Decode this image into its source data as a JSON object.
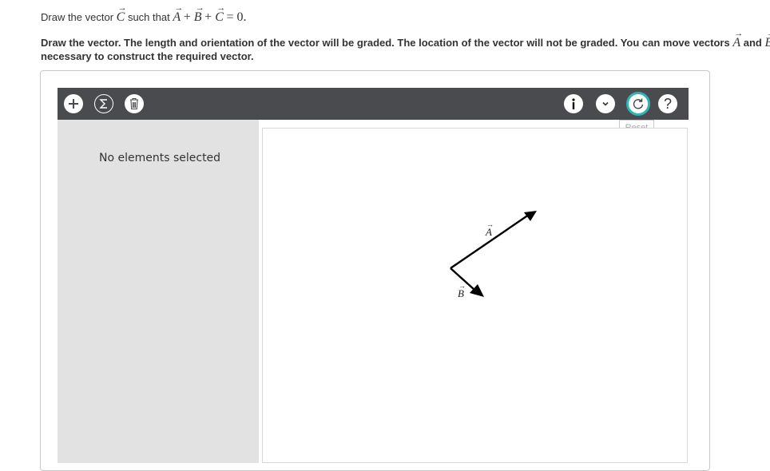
{
  "question": {
    "prefix": "Draw the vector ",
    "vec_c": "C",
    "middle": " such that ",
    "vec_a": "A",
    "plus1": " + ",
    "vec_b": "B",
    "plus2": " + ",
    "vec_c2": "C",
    "equals": " = 0."
  },
  "instructions": {
    "line1_prefix": "Draw the vector. The length and orientation of the vector will be graded. The location of the vector will not be graded. You can move vectors ",
    "vec_a": "A",
    "and": " and ",
    "vec_b_partial": "B",
    "line2": "necessary to construct the required vector."
  },
  "toolbar": {
    "add_icon": "plus-icon",
    "sum_icon": "sigma-icon",
    "delete_icon": "trash-icon",
    "info_icon": "info-icon",
    "chevron_icon": "chevron-down-icon",
    "reset_icon": "reset-icon",
    "help_label": "?",
    "reset_tooltip": "Reset"
  },
  "sidebar": {
    "status": "No elements selected"
  },
  "canvas": {
    "vectors": [
      {
        "label": "A"
      },
      {
        "label": "B"
      }
    ]
  },
  "colors": {
    "toolbar_bg": "#4a4b4f",
    "sidebar_bg": "#e2e2e2",
    "reset_ring": "#2fb3b3"
  }
}
